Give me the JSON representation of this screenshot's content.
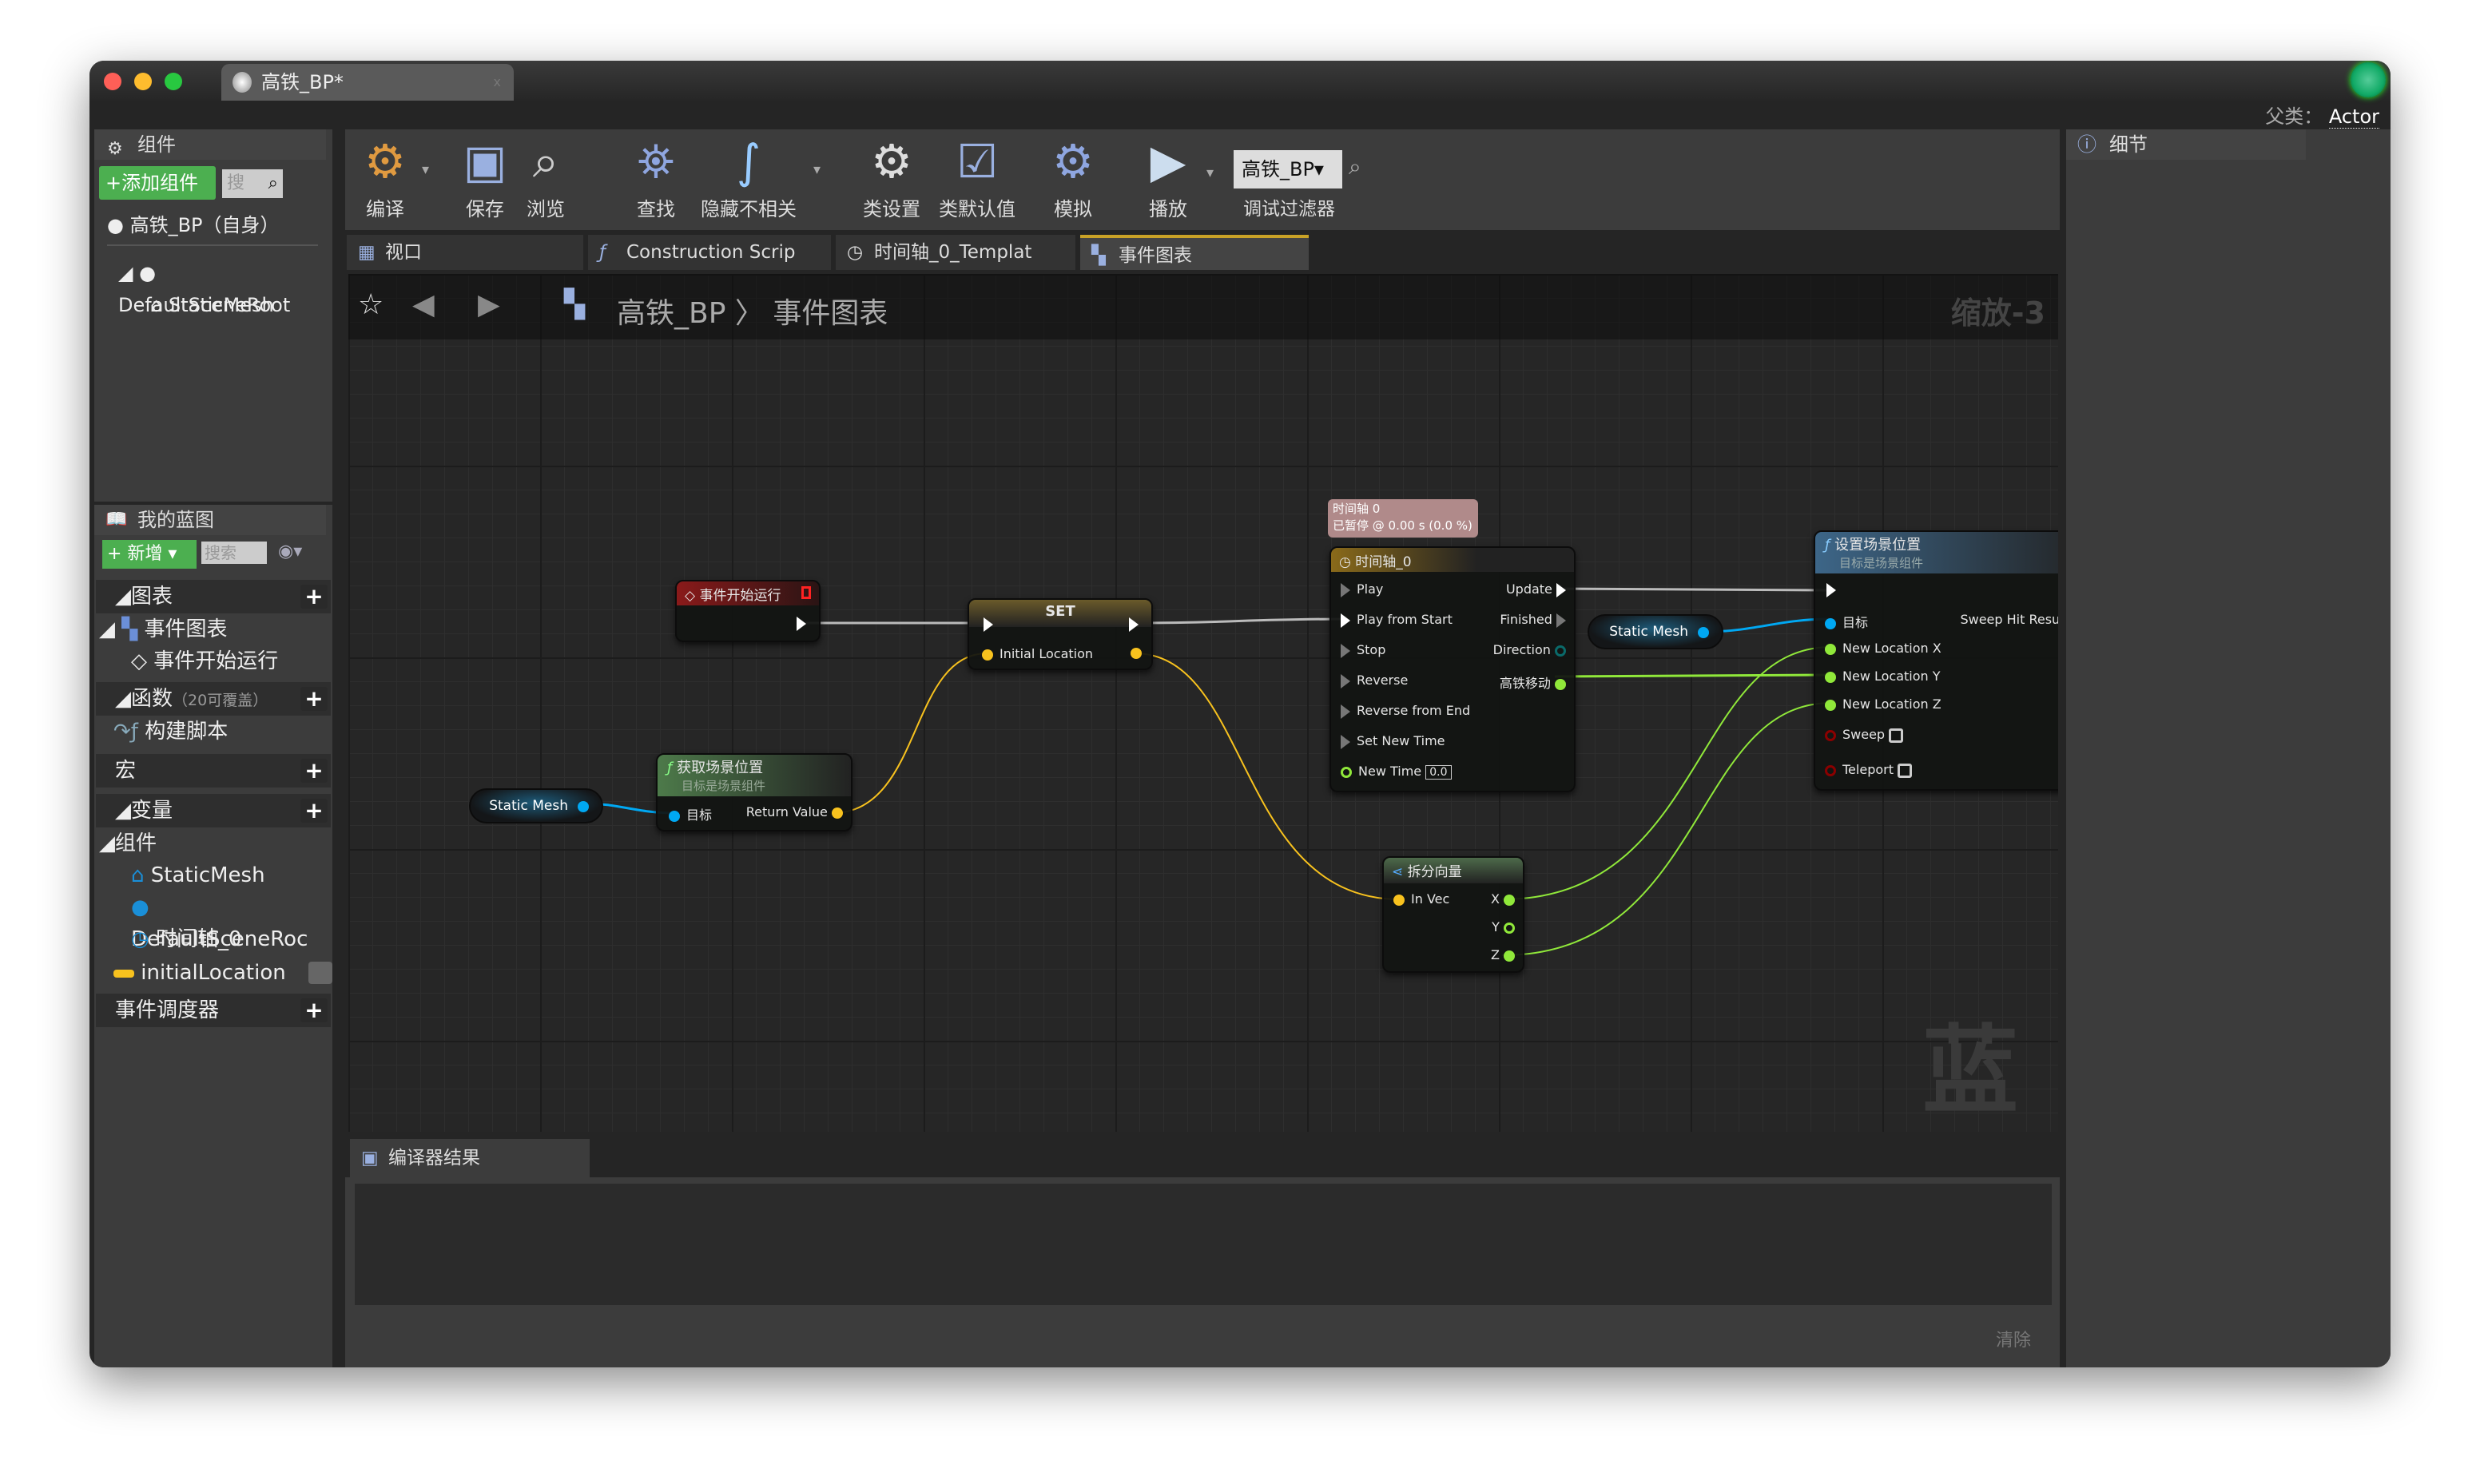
{
  "window": {
    "tab_title": "高铁_BP*",
    "parent_label": "父类：",
    "parent_value": "Actor"
  },
  "components_panel": {
    "title": "组件",
    "add_button": "+添加组件",
    "search_placeholder": "搜",
    "items": [
      "高铁_BP（自身）",
      "DefaultSceneRoot",
      "StaticMesh"
    ]
  },
  "toolbar": {
    "compile": "编译",
    "save": "保存",
    "browse": "浏览",
    "find": "查找",
    "hide_unrelated": "隐藏不相关",
    "class_settings": "类设置",
    "class_defaults": "类默认值",
    "simulate": "模拟",
    "play": "播放",
    "debug_object": "高铁_BP▾",
    "debug_filter": "调试过滤器"
  },
  "tabs": [
    "视口",
    "Construction Scrip",
    "时间轴_0_Templat",
    "事件图表"
  ],
  "graph": {
    "breadcrumb_root": "高铁_BP",
    "breadcrumb_sep": "〉",
    "breadcrumb_current": "事件图表",
    "zoom": "缩放-3",
    "watermark": "蓝图"
  },
  "my_blueprint": {
    "title": "我的蓝图",
    "new_button": "+ 新增 ▾",
    "search_placeholder": "搜索",
    "sections": {
      "graphs": "图表",
      "event_graph": "事件图表",
      "begin_play": "事件开始运行",
      "functions": "函数",
      "functions_note": "（20可覆盖）",
      "construction": "构建脚本",
      "macros": "宏",
      "variables": "变量",
      "components": "组件",
      "comp_items": [
        "StaticMesh",
        "DefaultSceneRoc",
        "时间轴_0"
      ],
      "var_item": "initialLocation",
      "dispatchers": "事件调度器"
    }
  },
  "details": {
    "title": "细节"
  },
  "nodes": {
    "begin_play": {
      "title": "事件开始运行"
    },
    "set": {
      "title": "SET",
      "pin": "Initial Location"
    },
    "get_loc": {
      "title": "获取场景位置",
      "subtitle": "目标是场景组件",
      "target": "目标",
      "ret": "Return Value"
    },
    "sm1": "Static Mesh",
    "sm2": "Static Mesh",
    "timeline_comment": [
      "时间轴 0",
      "已暂停 @ 0.00 s (0.0 %)"
    ],
    "timeline": {
      "title": "时间轴_0",
      "inputs": [
        "Play",
        "Play from Start",
        "Stop",
        "Reverse",
        "Reverse from End",
        "Set New Time",
        "New Time"
      ],
      "new_time_value": "0.0",
      "outputs": [
        "Update",
        "Finished",
        "Direction",
        "高铁移动"
      ]
    },
    "set_loc": {
      "title": "设置场景位置",
      "subtitle": "目标是场景组件",
      "target": "目标",
      "hit": "Sweep Hit Result",
      "inputs": [
        "New Location X",
        "New Location Y",
        "New Location Z",
        "Sweep",
        "Teleport"
      ]
    },
    "break": {
      "title": "拆分向量",
      "in": "In Vec",
      "outs": [
        "X",
        "Y",
        "Z"
      ]
    }
  },
  "compiler": {
    "title": "编译器结果",
    "clear": "清除"
  },
  "colors": {
    "exec": "#ffffff",
    "object": "#00a8f3",
    "vector": "#f8c21e",
    "float": "#90e83a",
    "bool": "#8b0000",
    "accent_green": "#4caf50"
  }
}
